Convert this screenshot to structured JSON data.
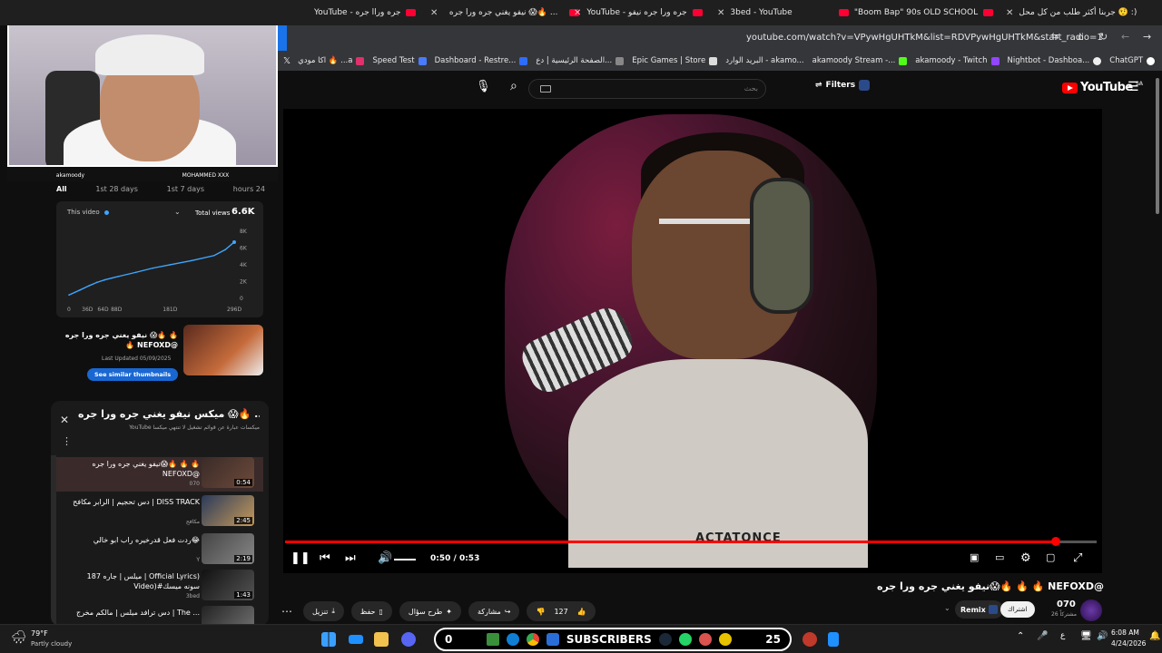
{
  "browser": {
    "tabs": [
      {
        "label": "YouTube - جره وراا جره"
      },
      {
        "label": "نيفو يغني جره ورا جره 😱🔥 ..."
      },
      {
        "label": "YouTube - جره ورا جره نيفو"
      },
      {
        "label": "3bed - YouTube"
      },
      {
        "label": "\"Boom Bap\" 90s OLD SCHOOL"
      },
      {
        "label": "جربنا أكثر طلب من كل محل 🤨 :)"
      }
    ],
    "url": "youtube.com/watch?v=VPywHgUHTkM&list=RDVPywHgUHTkM&start_radio=1",
    "bookmarks": [
      {
        "label": "اكا مودي 🔥 ...a",
        "color": "#e1306c"
      },
      {
        "label": "Speed Test",
        "color": "#4a7bff"
      },
      {
        "label": "Dashboard - Restre...",
        "color": "#2e6cff"
      },
      {
        "label": "الصفحة الرئيسية | دع...",
        "color": "#888888"
      },
      {
        "label": "Epic Games | Store",
        "color": "#dddddd"
      },
      {
        "label": "البريد الوارد - akamo...",
        "color": "#ea4335"
      },
      {
        "label": "akamoody Stream -...",
        "color": "#53fc18"
      },
      {
        "label": "akamoody - Twitch",
        "color": "#9146ff"
      },
      {
        "label": "Nightbot - Dashboa...",
        "color": "#2c2c2c"
      },
      {
        "label": "ChatGPT",
        "color": "#ffffff"
      }
    ]
  },
  "yt": {
    "search_placeholder": "بحث",
    "filters_label": "Filters",
    "logo": "YouTube",
    "logo_region": "SA"
  },
  "video": {
    "current_time": "0:50",
    "duration": "0:53",
    "time_display": "0:50 / 0:53",
    "progress": 0.95,
    "shirt_text": "ACTATONCE",
    "title": "نيفو يغني جره ورا جره😱🔥 🔥 🔥 NEFOXD@",
    "likes": "127",
    "action_share": "مشاركة",
    "action_remix_ar": "طرح سؤال",
    "action_save": "حفظ",
    "action_download": "تنزيل",
    "remix_label": "Remix",
    "subscribe_label": "اشتراك",
    "channel_name": "070",
    "channel_subs": "26 مشتركاً"
  },
  "stream_overlay": {
    "left_handle": "akamoody",
    "right_handle": "MOHAMMED XXX"
  },
  "analytics": {
    "tabs": [
      "All",
      "1st 28 days",
      "1st 7 days",
      "hours 24"
    ],
    "selector_label": "This video",
    "total_views_label": "Total views",
    "total_views": "6.6K"
  },
  "chart_data": {
    "type": "line",
    "x_ticks": [
      "0",
      "36D",
      "64D",
      "88D",
      "181D",
      "296D"
    ],
    "y_ticks": [
      "8K",
      "6K",
      "4K",
      "2K",
      "0"
    ],
    "ylim": [
      0,
      8000
    ],
    "x": [
      0,
      20,
      36,
      50,
      64,
      76,
      88,
      120,
      150,
      181,
      220,
      260,
      280,
      296
    ],
    "values": [
      300,
      900,
      1400,
      1800,
      2100,
      2300,
      2500,
      3000,
      3500,
      3900,
      4400,
      5000,
      5700,
      6600
    ]
  },
  "thumb_card": {
    "title": "نيفو يغني جره ورا جره 😱🔥 🔥 🔥 NEFOXD@",
    "updated": "Last Updated 05/09/2025",
    "button": "See similar thumbnails"
  },
  "playlist": {
    "title": "ميكس نيفو يغني جره ورا جره 😱🔥 ...",
    "subtitle": "YouTube ميكسات عبارة عن قوائم تشغيل لا تنتهي ميكساً",
    "items": [
      {
        "title": "نيفو يغني جره ورا جره😱🔥 🔥 🔥 NEFOXD@",
        "channel": "070",
        "duration": "0:54"
      },
      {
        "title": "دس تحجيم | الرابر مكافح | DISS TRACK",
        "channel": "مكافح",
        "duration": "2:45"
      },
      {
        "title": "ردت فعل قدرخيره راب ابو خالي😂",
        "channel": "Y",
        "duration": "2:19"
      },
      {
        "title": "ميلس | جاره 187 | Official Lyrics) Video)#سونه ميسك",
        "channel": "3bed",
        "duration": "1:43"
      },
      {
        "title": "دس ترافد ميلس | مالكم مخرج | The ...",
        "channel": "",
        "duration": ""
      }
    ]
  },
  "taskbar": {
    "weather_temp": "79°F",
    "weather_desc": "Partly cloudy",
    "subscribers_label": "SUBSCRIBERS",
    "subscribers_left": "0",
    "subscribers_right": "25",
    "time": "6:08 AM",
    "date": "4/24/2026"
  }
}
